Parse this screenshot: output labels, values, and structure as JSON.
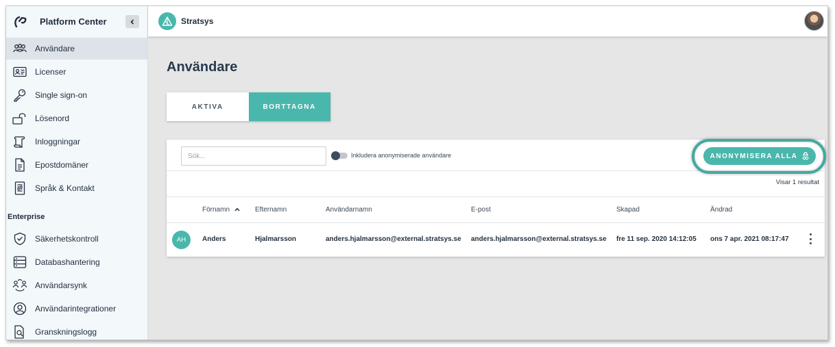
{
  "sidebar": {
    "title": "Platform Center",
    "items": [
      {
        "label": "Användare",
        "icon": "users-icon",
        "active": true
      },
      {
        "label": "Licenser",
        "icon": "id-card-icon"
      },
      {
        "label": "Single sign-on",
        "icon": "key-icon"
      },
      {
        "label": "Lösenord",
        "icon": "unlock-icon"
      },
      {
        "label": "Inloggningar",
        "icon": "scroll-icon"
      },
      {
        "label": "Epostdomäner",
        "icon": "document-icon"
      },
      {
        "label": "Språk & Kontakt",
        "icon": "settings-document-icon"
      }
    ],
    "section": "Enterprise",
    "enterprise_items": [
      {
        "label": "Säkerhetskontroll",
        "icon": "shield-icon"
      },
      {
        "label": "Databashantering",
        "icon": "database-icon"
      },
      {
        "label": "Användarsynk",
        "icon": "user-sync-icon"
      },
      {
        "label": "Användarintegrationer",
        "icon": "user-circle-icon"
      },
      {
        "label": "Granskningslogg",
        "icon": "search-document-icon"
      }
    ]
  },
  "topbar": {
    "app_name": "Stratsys"
  },
  "main": {
    "title": "Användare",
    "tabs": [
      {
        "label": "AKTIVA",
        "active": false
      },
      {
        "label": "BORTTAGNA",
        "active": true
      }
    ],
    "search": {
      "placeholder": "Sök..."
    },
    "toggle_label": "Inkludera anonymiserade användare",
    "anonymize_button": "ANONYMISERA ALLA",
    "result_count": "Visar 1 resultat",
    "columns": [
      "Förnamn",
      "Efternamn",
      "Användarnamn",
      "E-post",
      "Skapad",
      "Ändrad"
    ],
    "sorted_column": "Förnamn",
    "rows": [
      {
        "initials": "AH",
        "first_name": "Anders",
        "last_name": "Hjalmarsson",
        "username": "anders.hjalmarsson@external.stratsys.se",
        "email": "anders.hjalmarsson@external.stratsys.se",
        "created": "fre 11 sep. 2020 14:12:05",
        "modified": "ons 7 apr. 2021 08:17:47"
      }
    ]
  },
  "colors": {
    "accent": "#4ab7ad",
    "sidebar_bg": "#f3f8fb",
    "content_bg": "#e6e6e6",
    "text": "#1f2d3d"
  }
}
